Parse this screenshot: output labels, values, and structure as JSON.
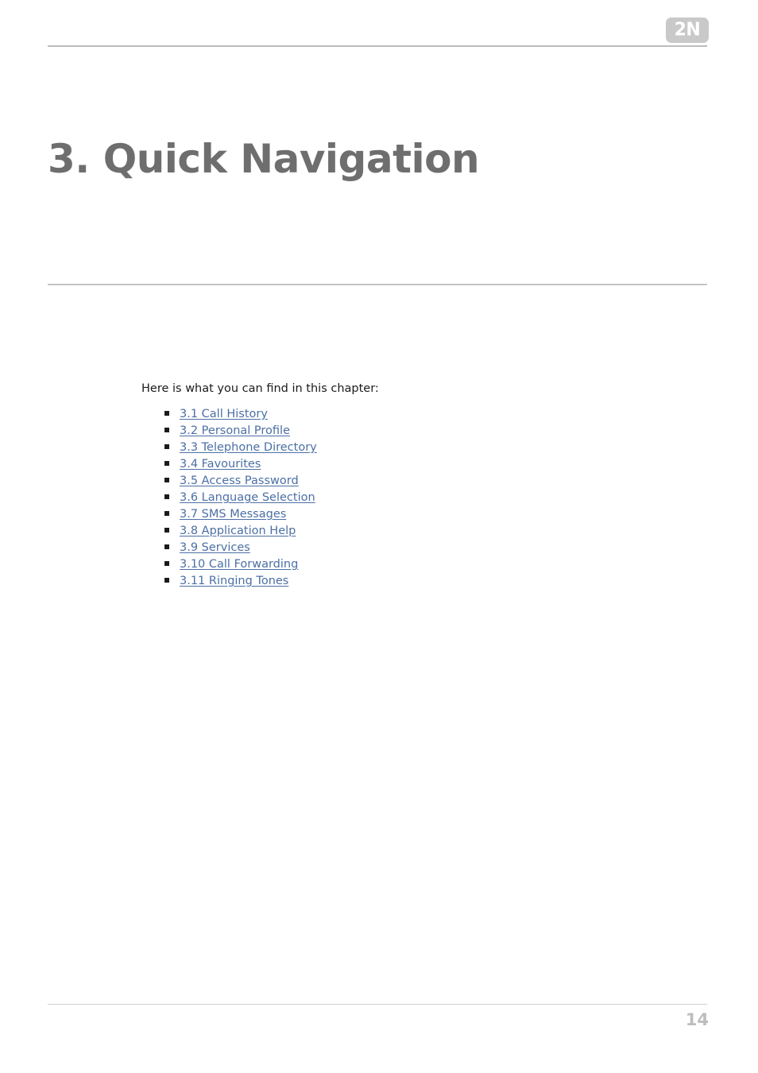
{
  "document": {
    "header": {
      "logo_text": "2N",
      "logo_color": "#c9c9c9"
    },
    "title": "3. Quick Navigation",
    "intro": "Here is what you can find in this chapter:",
    "toc": [
      {
        "label": "3.1 Call History"
      },
      {
        "label": "3.2 Personal Profile"
      },
      {
        "label": "3.3 Telephone Directory"
      },
      {
        "label": "3.4 Favourites"
      },
      {
        "label": "3.5 Access Password"
      },
      {
        "label": "3.6 Language Selection"
      },
      {
        "label": "3.7 SMS Messages"
      },
      {
        "label": "3.8 Application Help"
      },
      {
        "label": "3.9 Services"
      },
      {
        "label": "3.10 Call Forwarding"
      },
      {
        "label": "3.11 Ringing Tones"
      }
    ],
    "footer": {
      "page_number": "14"
    },
    "colors": {
      "link": "#4c6fa5",
      "title": "#6e6e6e",
      "rule": "#bdbdbd",
      "page_number": "#bdbdbd"
    }
  }
}
